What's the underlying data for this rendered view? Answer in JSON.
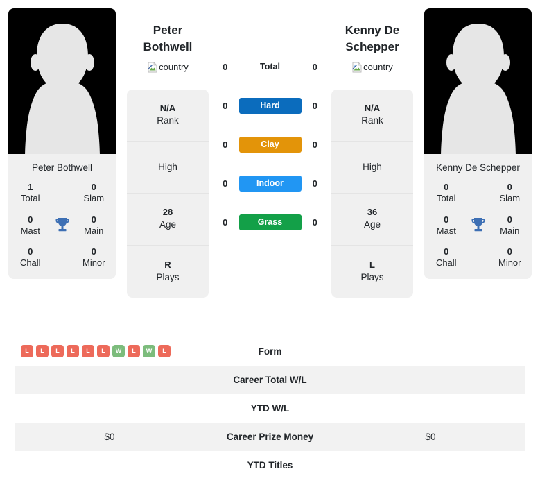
{
  "players": {
    "left": {
      "name": "Peter Bothwell",
      "display_name_line1": "Peter",
      "display_name_line2": "Bothwell",
      "country_alt": "country",
      "avatar_alt": "Peter Bothwell",
      "titles": {
        "total_value": "1",
        "total_label": "Total",
        "slam_value": "0",
        "slam_label": "Slam",
        "mast_value": "0",
        "mast_label": "Mast",
        "main_value": "0",
        "main_label": "Main",
        "chall_value": "0",
        "chall_label": "Chall",
        "minor_value": "0",
        "minor_label": "Minor"
      },
      "info": [
        {
          "value": "N/A",
          "label": "Rank"
        },
        {
          "value": "",
          "label": "High"
        },
        {
          "value": "28",
          "label": "Age"
        },
        {
          "value": "R",
          "label": "Plays"
        }
      ],
      "surface_counts": {
        "total": "0",
        "hard": "0",
        "clay": "0",
        "indoor": "0",
        "grass": "0"
      },
      "form": [
        "L",
        "L",
        "L",
        "L",
        "L",
        "L",
        "W",
        "L",
        "W",
        "L"
      ],
      "career_total_wl": "",
      "ytd_wl": "",
      "career_prize_money": "$0",
      "ytd_titles": ""
    },
    "right": {
      "name": "Kenny De Schepper",
      "display_name_line1": "Kenny De",
      "display_name_line2": "Schepper",
      "country_alt": "country",
      "avatar_alt": "Kenny De Schepper",
      "titles": {
        "total_value": "0",
        "total_label": "Total",
        "slam_value": "0",
        "slam_label": "Slam",
        "mast_value": "0",
        "mast_label": "Mast",
        "main_value": "0",
        "main_label": "Main",
        "chall_value": "0",
        "chall_label": "Chall",
        "minor_value": "0",
        "minor_label": "Minor"
      },
      "info": [
        {
          "value": "N/A",
          "label": "Rank"
        },
        {
          "value": "",
          "label": "High"
        },
        {
          "value": "36",
          "label": "Age"
        },
        {
          "value": "L",
          "label": "Plays"
        }
      ],
      "surface_counts": {
        "total": "0",
        "hard": "0",
        "clay": "0",
        "indoor": "0",
        "grass": "0"
      },
      "form": [],
      "career_total_wl": "",
      "ytd_wl": "",
      "career_prize_money": "$0",
      "ytd_titles": ""
    }
  },
  "surfaces": [
    {
      "key": "total",
      "label": "Total",
      "color": "transparent",
      "text_color": "#212529"
    },
    {
      "key": "hard",
      "label": "Hard",
      "color": "#0b6cbd",
      "text_color": "#ffffff"
    },
    {
      "key": "clay",
      "label": "Clay",
      "color": "#e39409",
      "text_color": "#ffffff"
    },
    {
      "key": "indoor",
      "label": "Indoor",
      "color": "#2196f3",
      "text_color": "#ffffff"
    },
    {
      "key": "grass",
      "label": "Grass",
      "color": "#13a048",
      "text_color": "#ffffff"
    }
  ],
  "table_rows": [
    {
      "key": "form",
      "label": "Form"
    },
    {
      "key": "career_total_wl",
      "label": "Career Total W/L"
    },
    {
      "key": "ytd_wl",
      "label": "YTD W/L"
    },
    {
      "key": "career_prize_money",
      "label": "Career Prize Money"
    },
    {
      "key": "ytd_titles",
      "label": "YTD Titles"
    }
  ],
  "colors": {
    "form_loss": "#ed6a5a",
    "form_win": "#7cbc7c",
    "trophy": "#3d6fb4",
    "card_bg": "#f0f0f0",
    "row_stripe": "#f2f2f2"
  },
  "icons": {
    "trophy": "trophy-icon",
    "broken_image": "broken-image-icon"
  }
}
